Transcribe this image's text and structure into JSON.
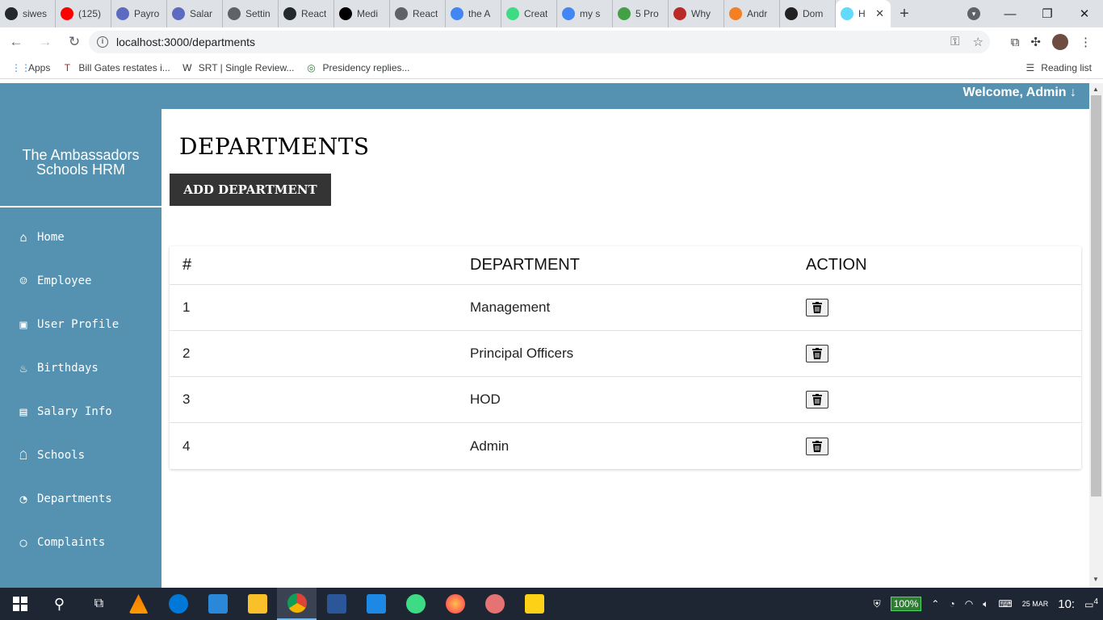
{
  "browser": {
    "tabs": [
      {
        "title": "siwes",
        "color": "#24292e"
      },
      {
        "title": "(125)",
        "color": "#ff0000"
      },
      {
        "title": "Payro",
        "color": "#5c6bc0"
      },
      {
        "title": "Salar",
        "color": "#5c6bc0"
      },
      {
        "title": "Settin",
        "color": "#5f6368"
      },
      {
        "title": "React",
        "color": "#24292e"
      },
      {
        "title": "Medi",
        "color": "#000000"
      },
      {
        "title": "React",
        "color": "#5f6368"
      },
      {
        "title": "the A",
        "color": "#4285f4"
      },
      {
        "title": "Creat",
        "color": "#3ddc84"
      },
      {
        "title": "my s",
        "color": "#4285f4"
      },
      {
        "title": "5 Pro",
        "color": "#43a047"
      },
      {
        "title": "Why",
        "color": "#b92b27"
      },
      {
        "title": "Andr",
        "color": "#f48024"
      },
      {
        "title": "Dom",
        "color": "#222222"
      }
    ],
    "active_tab": {
      "title": "H",
      "color": "#61dafb"
    },
    "url": "localhost:3000/departments",
    "bookmarks": [
      {
        "label": "Apps",
        "icon": "apps-grid-icon"
      },
      {
        "label": "Bill Gates restates i...",
        "icon": "tribune-icon"
      },
      {
        "label": "SRT | Single Review...",
        "icon": "wordpress-icon"
      },
      {
        "label": "Presidency replies...",
        "icon": "site-icon"
      }
    ],
    "reading_list": "Reading list"
  },
  "header": {
    "welcome": "Welcome, Admin ↓"
  },
  "sidebar": {
    "brand": "The Ambassadors Schools HRM",
    "items": [
      {
        "label": "Home",
        "icon": "⌂"
      },
      {
        "label": "Employee",
        "icon": "☺"
      },
      {
        "label": "User Profile",
        "icon": "▣"
      },
      {
        "label": "Birthdays",
        "icon": "♨"
      },
      {
        "label": "Salary Info",
        "icon": "▤"
      },
      {
        "label": "Schools",
        "icon": "☖"
      },
      {
        "label": "Departments",
        "icon": "◔"
      },
      {
        "label": "Complaints",
        "icon": "○"
      }
    ]
  },
  "main": {
    "title": "DEPARTMENTS",
    "add_button": "ADD DEPARTMENT",
    "table": {
      "headers": [
        "#",
        "DEPARTMENT",
        "ACTION"
      ],
      "rows": [
        {
          "id": "1",
          "name": "Management"
        },
        {
          "id": "2",
          "name": "Principal Officers"
        },
        {
          "id": "3",
          "name": "HOD"
        },
        {
          "id": "4",
          "name": "Admin"
        }
      ]
    }
  },
  "taskbar": {
    "battery": "100%",
    "notifications": "4",
    "clock": "10:",
    "date": "25 MAR"
  },
  "colors": {
    "primary": "#5592b2",
    "dark_button": "#343434"
  }
}
